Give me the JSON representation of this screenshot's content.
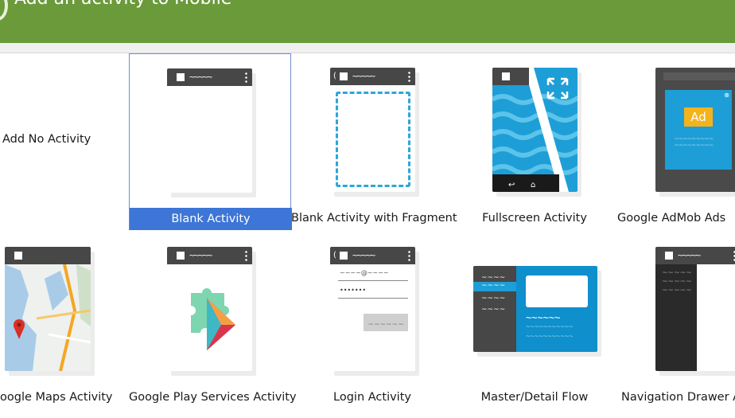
{
  "header": {
    "title": "Add an activity to Mobile"
  },
  "tiles": [
    {
      "label": "Add No Activity"
    },
    {
      "label": "Blank Activity"
    },
    {
      "label": "Blank Activity with Fragment"
    },
    {
      "label": "Fullscreen Activity"
    },
    {
      "label": "Google AdMob Ads"
    },
    {
      "label": "oogle Maps Activity"
    },
    {
      "label": "Google Play Services Activity"
    },
    {
      "label": "Login Activity"
    },
    {
      "label": "Master/Detail Flow"
    },
    {
      "label": "Navigation Drawer A"
    }
  ],
  "admob": {
    "badge": "Ad"
  },
  "login": {
    "email_hint": "~~~~@~~~~",
    "password_hint": "•••••••",
    "button_hint": "~~~~~~"
  },
  "statusbar": {
    "squiggle": "~~~~~"
  },
  "colors": {
    "header": "#6a9a3a",
    "selection": "#3d76d6",
    "accent_blue": "#1e9ed6",
    "dark_bar": "#474747"
  }
}
